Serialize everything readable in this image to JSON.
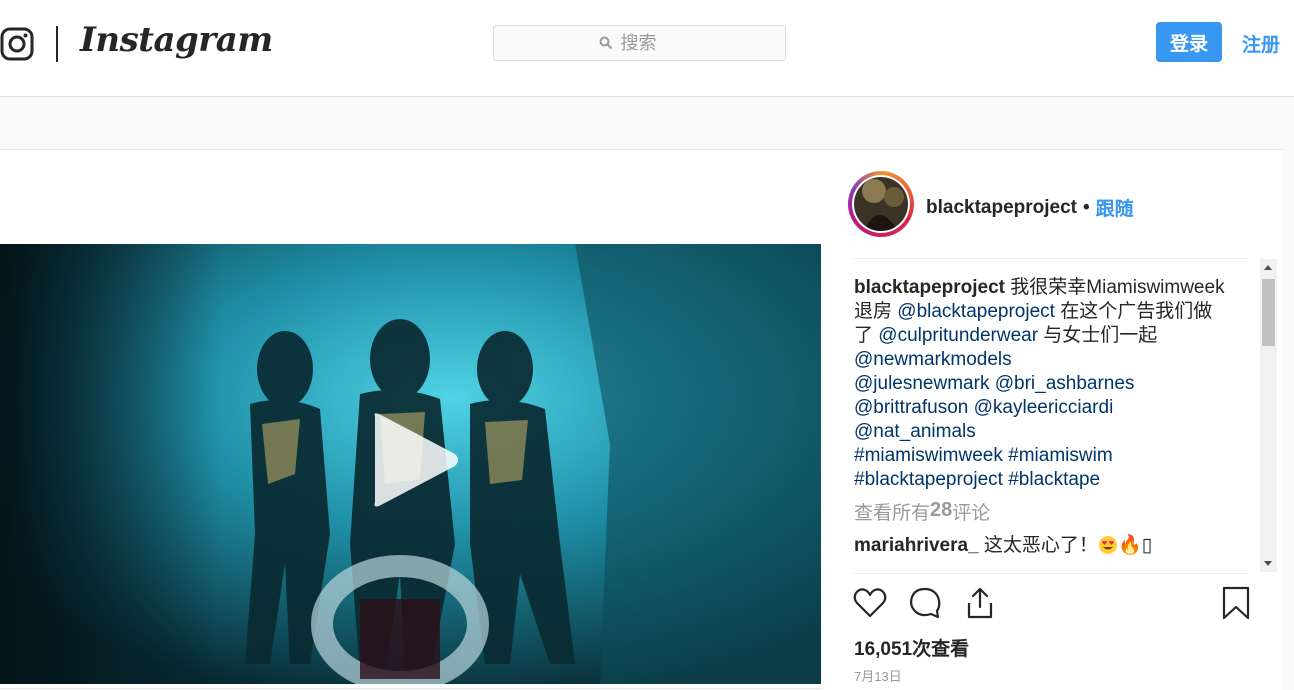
{
  "header": {
    "wordmark": "Instagram",
    "search_placeholder": "搜索",
    "login_label": "登录",
    "signup_label": "注册"
  },
  "post": {
    "username": "blacktapeproject",
    "separator": "•",
    "follow_label": "跟随",
    "caption": {
      "author": "blacktapeproject",
      "text_1": " 我很荣幸Miamiswimweek退房 ",
      "mention_1": "@blacktapeproject",
      "text_2": " 在这个广告我们做了 ",
      "mention_2": "@culpritunderwear",
      "text_3": " 与女士们一起",
      "mentions": [
        "@newmarkmodels",
        "@julesnewmark",
        "@bri_ashbarnes",
        "@brittrafuson",
        "@kayleericciardi",
        "@nat_animals"
      ],
      "hashtags": [
        "#miamiswimweek",
        "#miamiswim",
        "#blacktapeproject",
        "#blacktape"
      ]
    },
    "view_all": {
      "prefix": "查看所有",
      "count": "28",
      "suffix": "评论"
    },
    "comment": {
      "author": "mariahrivera_",
      "text": " 这太恶心了！",
      "trailing": "🔥",
      "tofu": "▯"
    },
    "views": "16,051次查看",
    "date": "7月13日"
  },
  "colors": {
    "accent": "#3897f0",
    "link": "#003569",
    "media_bg": "#0d3a46"
  },
  "icons": [
    "instagram-glyph-icon",
    "search-icon",
    "play-icon",
    "heart-icon",
    "comment-icon",
    "share-icon",
    "bookmark-icon"
  ]
}
